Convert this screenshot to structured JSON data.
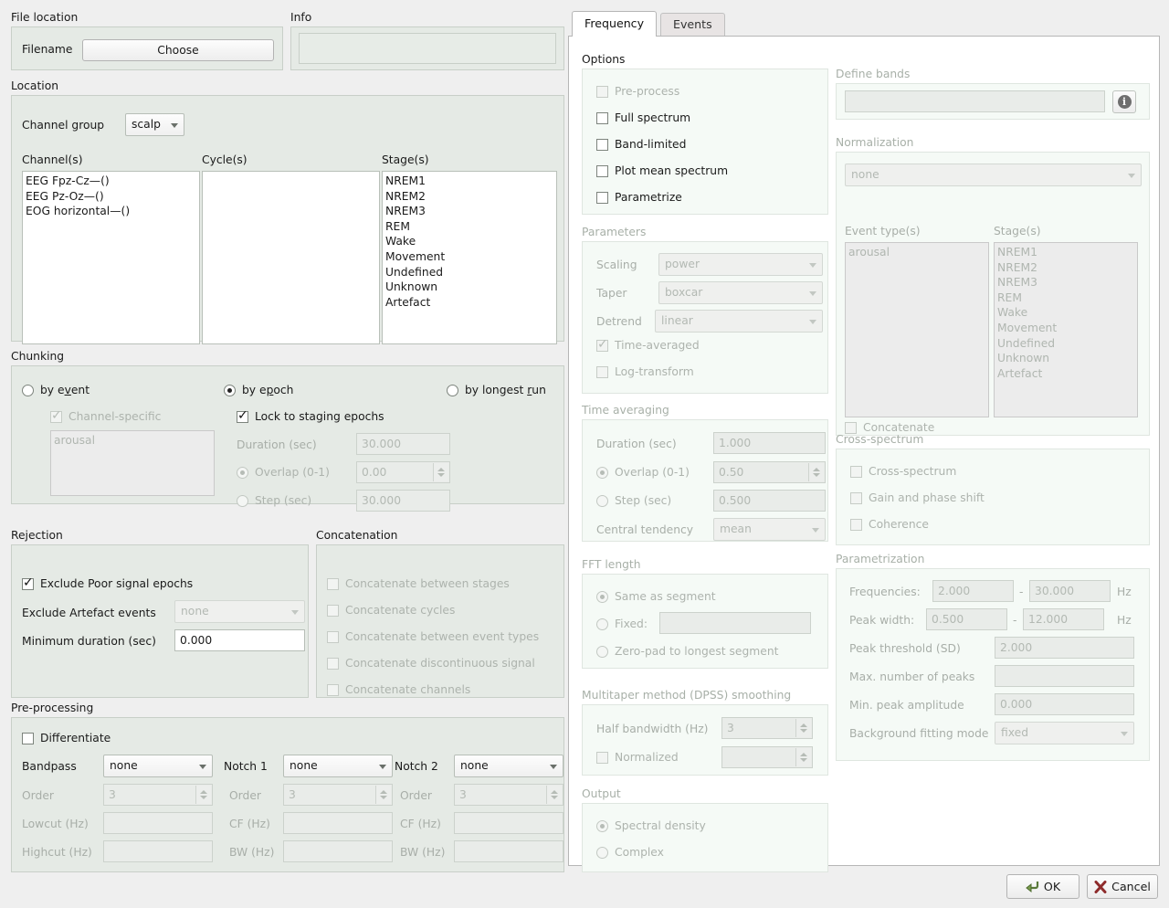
{
  "left": {
    "file_location": {
      "title": "File location",
      "filename_label": "Filename",
      "choose_button": "Choose"
    },
    "info": {
      "title": "Info",
      "value": ""
    },
    "location": {
      "title": "Location",
      "channel_group_label": "Channel group",
      "channel_group_value": "scalp",
      "channels_label": "Channel(s)",
      "cycles_label": "Cycle(s)",
      "stages_label": "Stage(s)",
      "channels": [
        "EEG Fpz-Cz—()",
        "EEG Pz-Oz—()",
        "EOG horizontal—()"
      ],
      "cycles": [],
      "stages": [
        "NREM1",
        "NREM2",
        "NREM3",
        "REM",
        "Wake",
        "Movement",
        "Undefined",
        "Unknown",
        "Artefact"
      ]
    },
    "chunking": {
      "title": "Chunking",
      "by_event": "by event",
      "by_event_acc": "v",
      "by_epoch": "by epoch",
      "by_epoch_acc": "p",
      "by_longest_run": "by longest run",
      "by_longest_run_acc": "r",
      "channel_specific": "Channel-specific",
      "event_types": [
        "arousal"
      ],
      "lock_to_staging": "Lock to staging epochs",
      "duration_label": "Duration (sec)",
      "duration_value": "30.000",
      "overlap_label": "Overlap (0-1)",
      "overlap_value": "0.00",
      "step_label": "Step (sec)",
      "step_value": "30.000"
    },
    "rejection": {
      "title": "Rejection",
      "exclude_poor": "Exclude Poor signal epochs",
      "exclude_artefact_label": "Exclude Artefact events",
      "exclude_artefact_value": "none",
      "min_duration_label": "Minimum duration (sec)",
      "min_duration_value": "0.000"
    },
    "concatenation": {
      "title": "Concatenation",
      "items": [
        "Concatenate between stages",
        "Concatenate cycles",
        "Concatenate between event types",
        "Concatenate discontinuous signal",
        "Concatenate channels"
      ]
    },
    "preprocessing": {
      "title": "Pre-processing",
      "differentiate": "Differentiate",
      "bandpass_label": "Bandpass",
      "bandpass_value": "none",
      "notch1_label": "Notch 1",
      "notch1_value": "none",
      "notch2_label": "Notch 2",
      "notch2_value": "none",
      "order_label": "Order",
      "order_value": "3",
      "lowcut_label": "Lowcut (Hz)",
      "lowcut_value": "",
      "highcut_label": "Highcut (Hz)",
      "highcut_value": "",
      "cf_label": "CF (Hz)",
      "cf_value": "",
      "bw_label": "BW (Hz)",
      "bw_value": ""
    }
  },
  "tabs": [
    {
      "label": "Frequency",
      "active": true
    },
    {
      "label": "Events",
      "active": false
    }
  ],
  "frequency": {
    "options": {
      "title": "Options",
      "items": [
        {
          "label": "Pre-process",
          "checked": false,
          "enabled": false
        },
        {
          "label": "Full spectrum",
          "checked": false,
          "enabled": true
        },
        {
          "label": "Band-limited",
          "checked": false,
          "enabled": true
        },
        {
          "label": "Plot mean spectrum",
          "checked": false,
          "enabled": true
        },
        {
          "label": "Parametrize",
          "checked": false,
          "enabled": true
        }
      ]
    },
    "parameters": {
      "title": "Parameters",
      "scaling_label": "Scaling",
      "scaling_value": "power",
      "taper_label": "Taper",
      "taper_value": "boxcar",
      "detrend_label": "Detrend",
      "detrend_value": "linear",
      "time_averaged": "Time-averaged",
      "log_transform": "Log-transform"
    },
    "time_averaging": {
      "title": "Time averaging",
      "duration_label": "Duration (sec)",
      "duration_value": "1.000",
      "overlap_label": "Overlap (0-1)",
      "overlap_value": "0.50",
      "step_label": "Step (sec)",
      "step_value": "0.500",
      "central_tendency_label": "Central tendency",
      "central_tendency_value": "mean"
    },
    "fft_length": {
      "title": "FFT length",
      "same_as_segment": "Same as segment",
      "fixed": "Fixed:",
      "fixed_value": "",
      "zero_pad": "Zero-pad to longest segment"
    },
    "multitaper": {
      "title": "Multitaper method (DPSS) smoothing",
      "half_bandwidth_label": "Half bandwidth (Hz)",
      "half_bandwidth_value": "3",
      "normalized_label": "Normalized",
      "normalized_value": ""
    },
    "output": {
      "title": "Output",
      "spectral_density": "Spectral density",
      "complex": "Complex"
    },
    "define_bands": {
      "title": "Define bands",
      "value": "",
      "info_icon": "info-icon",
      "info_glyph": "i"
    },
    "normalization": {
      "title": "Normalization",
      "mode": "none",
      "event_types_label": "Event type(s)",
      "stages_label": "Stage(s)",
      "event_types": [
        "arousal"
      ],
      "stages": [
        "NREM1",
        "NREM2",
        "NREM3",
        "REM",
        "Wake",
        "Movement",
        "Undefined",
        "Unknown",
        "Artefact"
      ],
      "concatenate": "Concatenate"
    },
    "cross_spectrum": {
      "title": "Cross-spectrum",
      "items": [
        "Cross-spectrum",
        "Gain and phase shift",
        "Coherence"
      ]
    },
    "parametrization": {
      "title": "Parametrization",
      "frequencies_label": "Frequencies:",
      "frequencies_low": "2.000",
      "frequencies_high": "30.000",
      "frequencies_unit": "Hz",
      "range_sep": "-",
      "peak_width_label": "Peak width:",
      "peak_width_low": "0.500",
      "peak_width_high": "12.000",
      "peak_width_unit": "Hz",
      "peak_threshold_label": "Peak threshold (SD)",
      "peak_threshold_value": "2.000",
      "max_peaks_label": "Max. number of peaks",
      "max_peaks_value": "",
      "min_peak_amp_label": "Min. peak amplitude",
      "min_peak_amp_value": "0.000",
      "background_mode_label": "Background fitting mode",
      "background_mode_value": "fixed"
    }
  },
  "buttons": {
    "ok": "OK",
    "ok_icon": "enter-arrow-icon",
    "cancel": "Cancel",
    "cancel_icon": "x-mark-icon"
  }
}
